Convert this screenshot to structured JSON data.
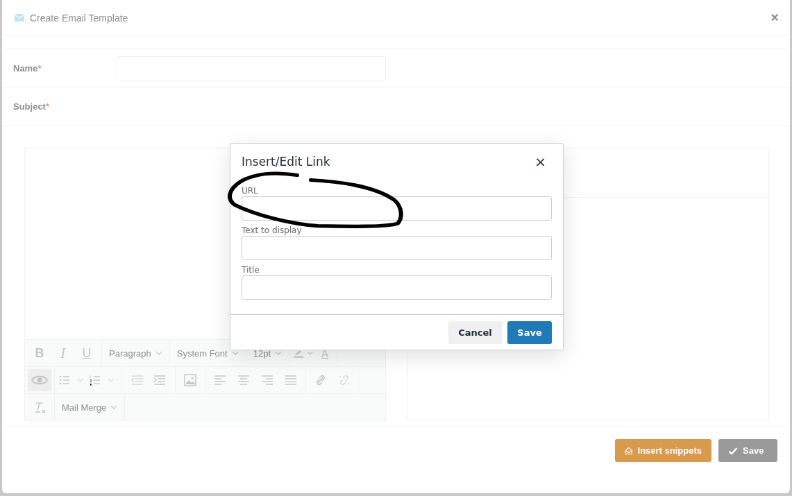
{
  "window": {
    "title": "Create Email Template",
    "close": "×"
  },
  "form": {
    "fields": [
      {
        "label": "Name",
        "required_mark": "*",
        "kind": "input"
      },
      {
        "label": "Subject",
        "required_mark": "*",
        "kind": "none"
      }
    ]
  },
  "editor": {
    "toolbar": {
      "bold": "B",
      "italic": "I",
      "underline": "U",
      "text_color": "A",
      "block_format": "Paragraph",
      "font_family": "System Font",
      "font_size": "12pt",
      "mail_merge": "Mail Merge",
      "preview_selected": true
    }
  },
  "footer": {
    "buttons": [
      {
        "label": "Insert snippets",
        "kind": "snippets"
      },
      {
        "label": "Save",
        "kind": "save"
      }
    ]
  },
  "dialog": {
    "title": "Insert/Edit Link",
    "close": "×",
    "fields": [
      {
        "label": "URL"
      },
      {
        "label": "Text to display"
      },
      {
        "label": "Title"
      }
    ],
    "buttons": [
      {
        "label": "Cancel",
        "kind": "secondary"
      },
      {
        "label": "Save",
        "kind": "primary"
      }
    ]
  }
}
